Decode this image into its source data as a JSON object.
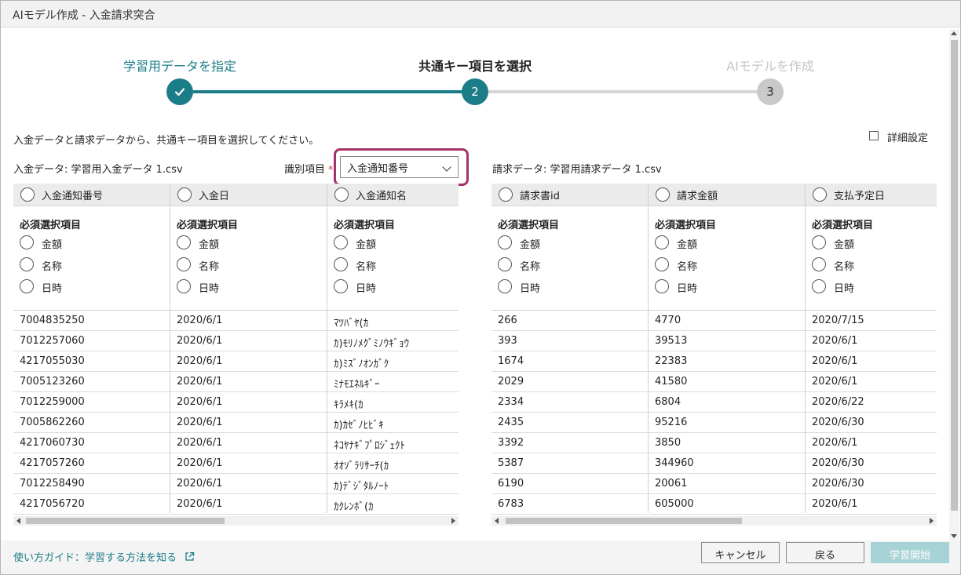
{
  "window": {
    "title": "AIモデル作成 - 入金請求突合"
  },
  "stepper": {
    "steps": [
      {
        "label": "学習用データを指定",
        "status": "done"
      },
      {
        "label": "共通キー項目を選択",
        "number": "2",
        "status": "current"
      },
      {
        "label": "AIモデルを作成",
        "number": "3",
        "status": "pending"
      }
    ],
    "colors": {
      "done": "#1b7d88",
      "current_label": "#222222",
      "pending": "#c9c9c9",
      "pending_label": "#c6c6c6"
    }
  },
  "instruction": "入金データと請求データから、共通キー項目を選択してください。",
  "advanced": {
    "label": "詳細設定",
    "checked": false
  },
  "left_source": "入金データ: 学習用入金データ 1.csv",
  "identifier": {
    "label": "識別項目",
    "required_mark": "*",
    "value": "入金通知番号"
  },
  "right_source": "請求データ: 学習用請求データ 1.csv",
  "required_title": "必須選択項目",
  "options": [
    "金額",
    "名称",
    "日時"
  ],
  "left_table": {
    "columns": [
      "入金通知番号",
      "入金日",
      "入金通知名"
    ],
    "rows": [
      [
        "7004835250",
        "2020/6/1",
        "ﾏﾂﾊﾞﾔ(ｶ"
      ],
      [
        "7012257060",
        "2020/6/1",
        "ｶ)ﾓﾘﾉﾒｸﾞﾐﾉｳｷﾞｮｳ"
      ],
      [
        "4217055030",
        "2020/6/1",
        "ｶ)ﾐｽﾞﾉｵﾝｶﾞｸ"
      ],
      [
        "7005123260",
        "2020/6/1",
        "ﾐﾅﾓｴﾈﾙｷﾞｰ"
      ],
      [
        "7012259000",
        "2020/6/1",
        "ｷﾗﾒｷ(ｶ"
      ],
      [
        "7005862260",
        "2020/6/1",
        "ｶ)ｶｾﾞﾉﾋﾋﾞｷ"
      ],
      [
        "4217060730",
        "2020/6/1",
        "ﾈｺﾔﾅｷﾞﾌﾟﾛｼﾞｪｸﾄ"
      ],
      [
        "4217057260",
        "2020/6/1",
        "ｵｵｿﾞﾗﾘｻｰﾁ(ｶ"
      ],
      [
        "7012258490",
        "2020/6/1",
        "ｶ)ﾃﾞｼﾞﾀﾙﾉｰﾄ"
      ],
      [
        "4217056720",
        "2020/6/1",
        "ｶｸﾚﾝﾎﾞ(ｶ"
      ]
    ]
  },
  "right_table": {
    "columns": [
      "請求書id",
      "請求金額",
      "支払予定日"
    ],
    "rows": [
      [
        "266",
        "4770",
        "2020/7/15"
      ],
      [
        "393",
        "39513",
        "2020/6/1"
      ],
      [
        "1674",
        "22383",
        "2020/6/1"
      ],
      [
        "2029",
        "41580",
        "2020/6/1"
      ],
      [
        "2334",
        "6804",
        "2020/6/22"
      ],
      [
        "2435",
        "95216",
        "2020/6/30"
      ],
      [
        "3392",
        "3850",
        "2020/6/1"
      ],
      [
        "5387",
        "344960",
        "2020/6/30"
      ],
      [
        "6190",
        "20061",
        "2020/6/30"
      ],
      [
        "6783",
        "605000",
        "2020/6/1"
      ]
    ]
  },
  "footer": {
    "guide": "使い方ガイド：学習する方法を知る",
    "cancel": "キャンセル",
    "back": "戻る",
    "start": "学習開始"
  }
}
